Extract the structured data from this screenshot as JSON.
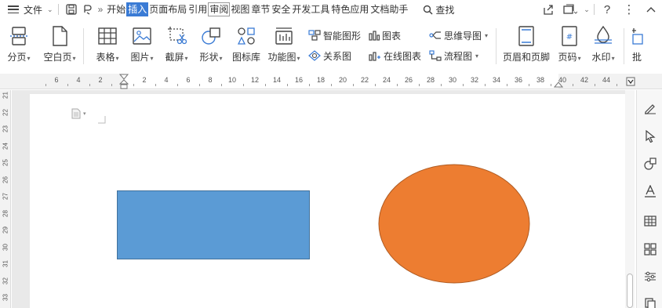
{
  "menubar": {
    "file_label": "文件",
    "tabs": [
      "开始",
      "插入",
      "页面布局",
      "引用",
      "审阅",
      "视图",
      "章节",
      "安全",
      "开发工具",
      "特色应用",
      "文档助手"
    ],
    "active_tab": "插入",
    "search_label": "查找"
  },
  "ribbon": {
    "page_break": "分页",
    "blank_page": "空白页",
    "table": "表格",
    "picture": "图片",
    "screenshot": "截屏",
    "shape": "形状",
    "icon_lib": "图标库",
    "func_chart": "功能图",
    "smart_art": "智能图形",
    "chart": "图表",
    "relation": "关系图",
    "online_chart": "在线图表",
    "mind_map": "思维导图",
    "flow_chart": "流程图",
    "header_footer": "页眉和页脚",
    "page_number": "页码",
    "watermark": "水印",
    "partial": "批"
  },
  "ruler": {
    "labels": [
      "6",
      "4",
      "2",
      "2",
      "4",
      "6",
      "8",
      "10",
      "12",
      "14",
      "16",
      "18",
      "20",
      "22",
      "24",
      "26",
      "28",
      "30",
      "32",
      "34",
      "36",
      "38",
      "40",
      "42",
      "44"
    ]
  },
  "vruler": {
    "labels": [
      "21",
      "22",
      "23",
      "24",
      "25",
      "26",
      "27",
      "28",
      "29",
      "30",
      "31",
      "32",
      "33"
    ]
  },
  "colors": {
    "active_tab": "#3a7bd5",
    "rectangle_fill": "#5b9bd5",
    "rectangle_stroke": "#41719c",
    "ellipse_fill": "#ed7d31",
    "ellipse_stroke": "#ae5a21"
  }
}
